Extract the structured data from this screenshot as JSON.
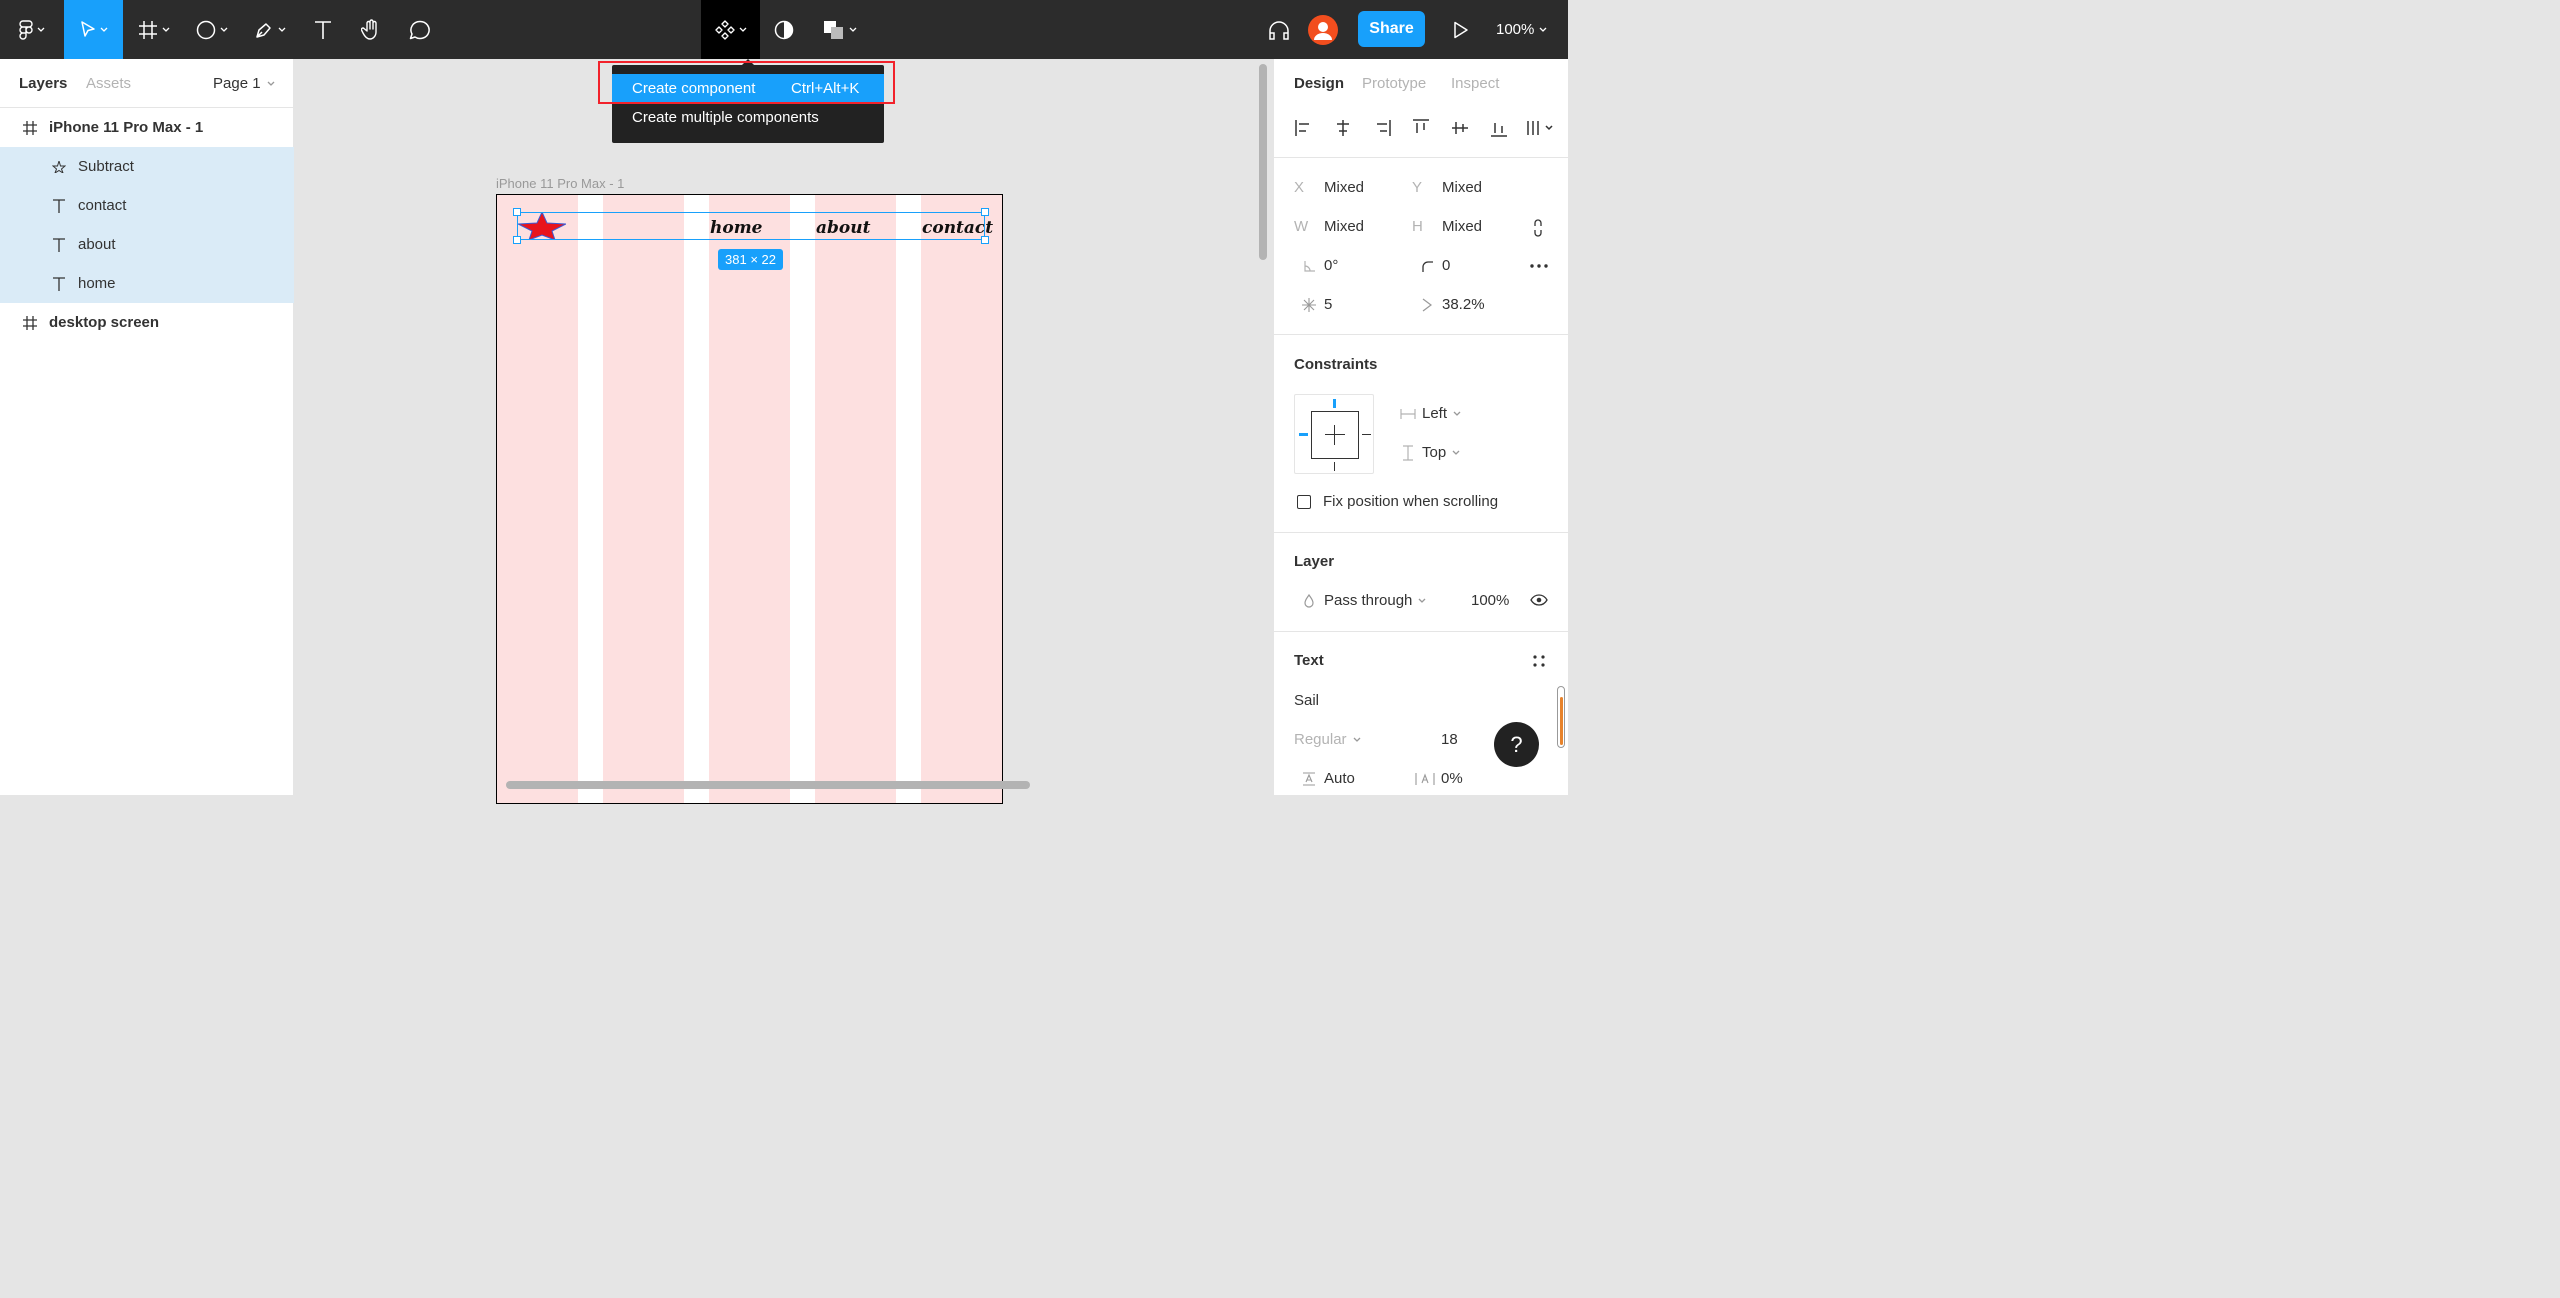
{
  "toolbar": {
    "tools": [
      "main-menu",
      "move",
      "frame",
      "shape",
      "pen",
      "text",
      "hand",
      "comment"
    ],
    "center_tools": [
      "component",
      "mask",
      "boolean"
    ],
    "share_label": "Share",
    "zoom_label": "100%"
  },
  "left_panel": {
    "tabs": [
      "Layers",
      "Assets"
    ],
    "page_label": "Page 1",
    "layers": [
      {
        "name": "iPhone 11 Pro Max - 1",
        "icon": "frame-icon",
        "selected": false
      },
      {
        "name": "Subtract",
        "icon": "boolean-subtract-icon",
        "selected": true
      },
      {
        "name": "contact",
        "icon": "text-icon",
        "selected": true
      },
      {
        "name": "about",
        "icon": "text-icon",
        "selected": true
      },
      {
        "name": "home",
        "icon": "text-icon",
        "selected": true
      },
      {
        "name": "desktop screen",
        "icon": "frame-icon",
        "selected": false
      }
    ]
  },
  "canvas": {
    "frame_label": "iPhone 11 Pro Max - 1",
    "nav": {
      "home": "home",
      "about": "about",
      "contact": "contact"
    },
    "selection_size": "381 × 22",
    "colors": {
      "grid_column": "#fde0e0",
      "star": "#e8141c",
      "selection": "#18a0fb"
    }
  },
  "menu": {
    "items": [
      {
        "label": "Create component",
        "shortcut": "Ctrl+Alt+K",
        "highlighted": true
      },
      {
        "label": "Create multiple components",
        "shortcut": "",
        "highlighted": false
      }
    ]
  },
  "right_panel": {
    "tabs": [
      "Design",
      "Prototype",
      "Inspect"
    ],
    "x": {
      "label": "X",
      "value": "Mixed"
    },
    "y": {
      "label": "Y",
      "value": "Mixed"
    },
    "w": {
      "label": "W",
      "value": "Mixed"
    },
    "h": {
      "label": "H",
      "value": "Mixed"
    },
    "rotation": "0°",
    "corner_radius": "0",
    "star_count": "5",
    "star_ratio": "38.2%",
    "constraints": {
      "title": "Constraints",
      "horizontal": "Left",
      "vertical": "Top",
      "fix_label": "Fix position when scrolling"
    },
    "layer": {
      "title": "Layer",
      "blend": "Pass through",
      "opacity": "100%"
    },
    "text": {
      "title": "Text",
      "font": "Sail",
      "style": "Regular",
      "size": "18",
      "line_height": "Auto",
      "letter_spacing": "0%"
    }
  },
  "help_label": "?"
}
